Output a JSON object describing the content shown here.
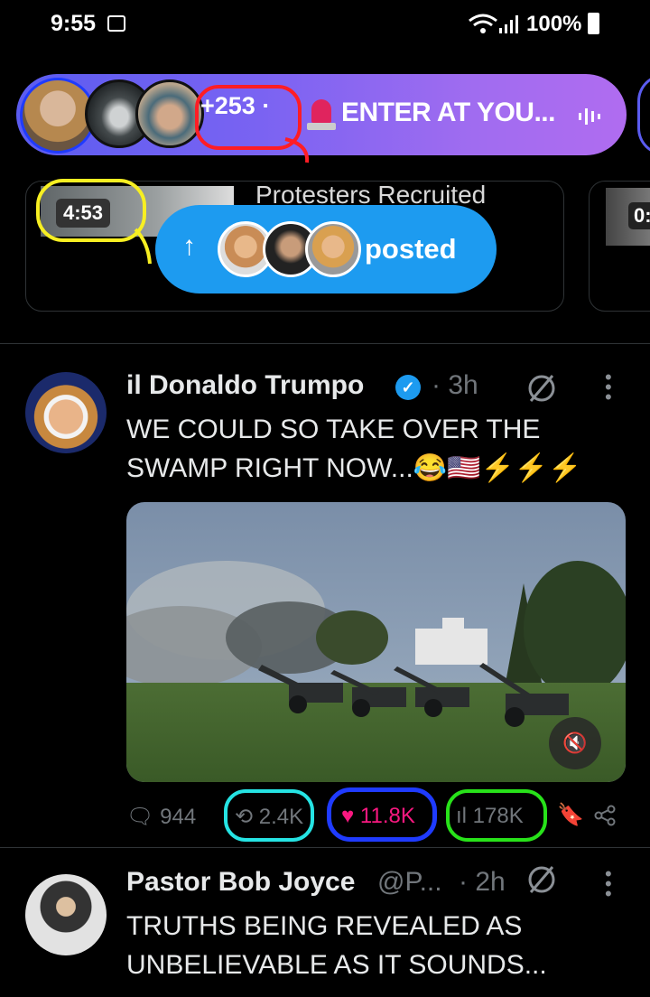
{
  "status": {
    "time": "9:55",
    "battery": "100%"
  },
  "spaces": {
    "listener_count": "+253",
    "separator": "·",
    "title": "ENTER AT YOU...",
    "colors": {
      "gradient_start": "#5b5cf0",
      "gradient_end": "#b06cf0"
    }
  },
  "previews": [
    {
      "duration": "4:53",
      "title": "Protesters Recruited"
    },
    {
      "duration": "0:"
    }
  ],
  "posted_pill": {
    "label": "posted",
    "icon": "arrow-up-icon",
    "color": "#1d9bf0"
  },
  "tweets": [
    {
      "author": "il Donaldo Trumpo",
      "verified": true,
      "time": "3h",
      "text_line1": "WE COULD SO TAKE OVER THE",
      "text_line2": "SWAMP RIGHT NOW...😂🇺🇸⚡⚡⚡",
      "actions": {
        "replies": "944",
        "reposts": "2.4K",
        "likes": "11.8K",
        "views": "178K"
      },
      "media_muted": true
    },
    {
      "author": "Pastor Bob Joyce",
      "handle": "@P...",
      "time": "2h",
      "text_line1": "TRUTHS BEING REVEALED AS",
      "text_line2": "UNBELIEVABLE AS IT SOUNDS..."
    }
  ],
  "annotation_colors": {
    "red": "#ff1d25",
    "yellow": "#f7ef22",
    "cyan": "#25e3e3",
    "blue": "#1f3bff",
    "green": "#28e21a"
  }
}
